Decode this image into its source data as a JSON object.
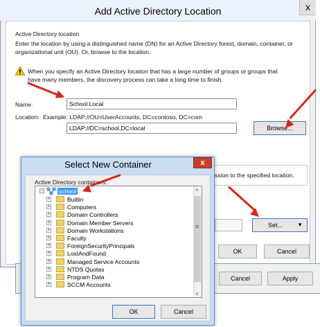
{
  "outer_dialog": {
    "title": "Add Active Directory Location",
    "close_glyph": "x",
    "section_label": "Active Directory location",
    "description_line1": "Enter the location by using a distinguished name (DN) for an Active Directory forest, domain, container, or",
    "description_line2": "organizational unit (OU). Or, browse to the location.",
    "warning_icon": "warning-icon",
    "warning_line1": "When you specify an Active Directory location that has a large number of groups or groups that",
    "warning_line2": "have many members, the discovery process can take a long time to finish.",
    "name_label": "Name:",
    "name_value": "School.Local",
    "location_label": "Location:",
    "location_example": "Example: LDAP://OU=UserAccounts, DC=contoso, DC=com",
    "location_value": "LDAP://DC=school,DC=local",
    "browse_button": "Browse...",
    "permission_text": "ission to the specified location.",
    "set_button": "Set...",
    "ok_button": "OK",
    "cancel_button": "Cancel"
  },
  "behind_dialog": {
    "cancel_button": "Cancel",
    "apply_button": "Apply"
  },
  "inner_dialog": {
    "title": "Select New Container",
    "close_glyph": "x",
    "tree_label": "Active Directory containers:",
    "tree_root": "school",
    "tree_items": [
      "Builtin",
      "Computers",
      "Domain Controllers",
      "Domain Member Servers",
      "Domain Workstations",
      "Faculty",
      "ForeignSecurityPrincipals",
      "LostAndFound",
      "Managed Service Accounts",
      "NTDS Quotas",
      "Program Data",
      "SCCM Accounts"
    ],
    "ok_button": "OK",
    "cancel_button": "Cancel"
  },
  "colors": {
    "selection": "#3399ff",
    "annotation_arrow": "#d8261a",
    "close_button": "#c7402c"
  }
}
